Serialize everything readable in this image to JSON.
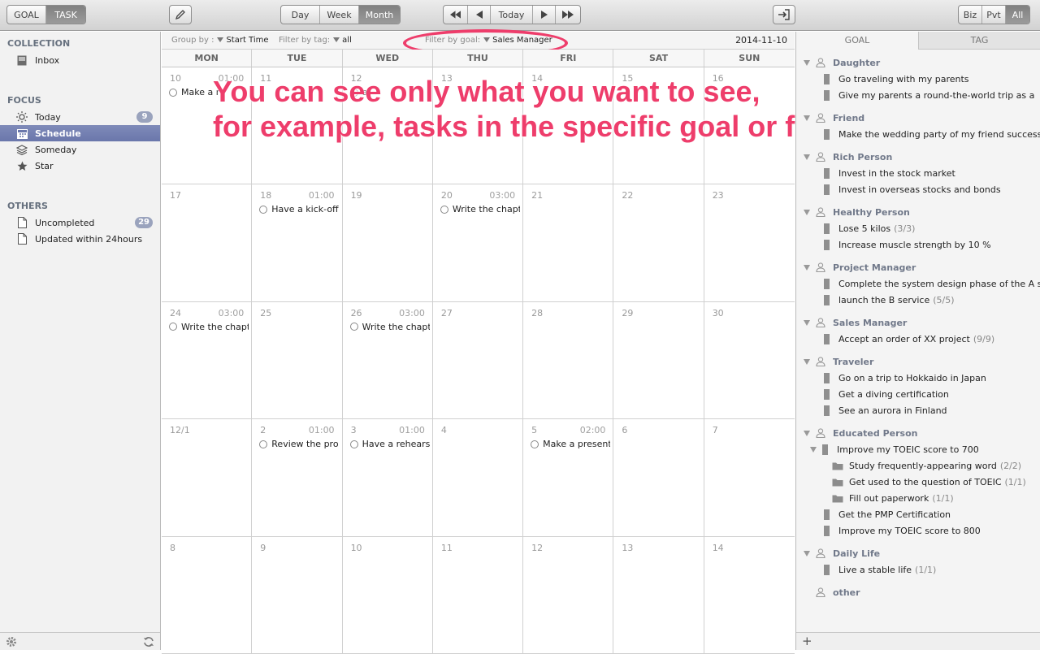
{
  "toolbar": {
    "mode_tabs": [
      "GOAL",
      "TASK"
    ],
    "view_tabs": [
      "Day",
      "Week",
      "Month"
    ],
    "nav_today": "Today",
    "scope_tabs": [
      "Biz",
      "Pvt",
      "All"
    ]
  },
  "sidebar": {
    "collection_title": "COLLECTION",
    "inbox": "Inbox",
    "focus_title": "FOCUS",
    "today": "Today",
    "today_count": "9",
    "schedule": "Schedule",
    "someday": "Someday",
    "star": "Star",
    "others_title": "OTHERS",
    "uncompleted": "Uncompleted",
    "uncompleted_count": "29",
    "updated": "Updated within 24hours"
  },
  "filter_bar": {
    "group_label": "Group by :",
    "group_value": "Start Time",
    "tag_label": "Filter by tag:",
    "tag_value": "all",
    "goal_label": "Filter by goal:",
    "goal_value": "Sales Manager",
    "date": "2014-11-10"
  },
  "calendar": {
    "weekdays": [
      "MON",
      "TUE",
      "WED",
      "THU",
      "FRI",
      "SAT",
      "SUN"
    ],
    "weeks": [
      [
        {
          "day": "10",
          "time": "01:00",
          "task": "Make a r"
        },
        {
          "day": "11",
          "time": "",
          "task": ""
        },
        {
          "day": "12",
          "time": "",
          "task": "a"
        },
        {
          "day": "13",
          "time": "",
          "task": ""
        },
        {
          "day": "14",
          "time": "",
          "task": ""
        },
        {
          "day": "15",
          "time": "",
          "task": ""
        },
        {
          "day": "16",
          "time": "",
          "task": ""
        }
      ],
      [
        {
          "day": "17",
          "time": "",
          "task": ""
        },
        {
          "day": "18",
          "time": "01:00",
          "task": "Have a kick-off"
        },
        {
          "day": "19",
          "time": "",
          "task": ""
        },
        {
          "day": "20",
          "time": "03:00",
          "task": "Write the chapt"
        },
        {
          "day": "21",
          "time": "",
          "task": ""
        },
        {
          "day": "22",
          "time": "",
          "task": ""
        },
        {
          "day": "23",
          "time": "",
          "task": ""
        }
      ],
      [
        {
          "day": "24",
          "time": "03:00",
          "task": "Write the chapt"
        },
        {
          "day": "25",
          "time": "",
          "task": ""
        },
        {
          "day": "26",
          "time": "03:00",
          "task": "Write the chapt"
        },
        {
          "day": "27",
          "time": "",
          "task": ""
        },
        {
          "day": "28",
          "time": "",
          "task": ""
        },
        {
          "day": "29",
          "time": "",
          "task": ""
        },
        {
          "day": "30",
          "time": "",
          "task": ""
        }
      ],
      [
        {
          "day": "12/1",
          "time": "",
          "task": ""
        },
        {
          "day": "2",
          "time": "01:00",
          "task": "Review the prop"
        },
        {
          "day": "3",
          "time": "01:00",
          "task": "Have a rehears"
        },
        {
          "day": "4",
          "time": "",
          "task": ""
        },
        {
          "day": "5",
          "time": "02:00",
          "task": "Make a present"
        },
        {
          "day": "6",
          "time": "",
          "task": ""
        },
        {
          "day": "7",
          "time": "",
          "task": ""
        }
      ],
      [
        {
          "day": "8",
          "time": "",
          "task": ""
        },
        {
          "day": "9",
          "time": "",
          "task": ""
        },
        {
          "day": "10",
          "time": "",
          "task": ""
        },
        {
          "day": "11",
          "time": "",
          "task": ""
        },
        {
          "day": "12",
          "time": "",
          "task": ""
        },
        {
          "day": "13",
          "time": "",
          "task": ""
        },
        {
          "day": "14",
          "time": "",
          "task": ""
        }
      ]
    ]
  },
  "overlay": {
    "line1": "You can see only what you want to see,",
    "line2": "for example, tasks in the specific goal or folder."
  },
  "goals_panel": {
    "tabs": [
      "GOAL",
      "TAG"
    ],
    "rows": [
      {
        "type": "role",
        "label": "Daughter",
        "count": ""
      },
      {
        "type": "goal",
        "label": "Go traveling with my parents",
        "count": ""
      },
      {
        "type": "goal",
        "label": "Give my parents a round-the-world trip as a",
        "count": ""
      },
      {
        "type": "role",
        "label": "Friend",
        "count": ""
      },
      {
        "type": "goal",
        "label": "Make the wedding party of my friend successful",
        "count": ""
      },
      {
        "type": "role",
        "label": "Rich Person",
        "count": ""
      },
      {
        "type": "goal",
        "label": "Invest in the stock market",
        "count": ""
      },
      {
        "type": "goal",
        "label": "Invest in overseas stocks and bonds",
        "count": ""
      },
      {
        "type": "role",
        "label": "Healthy Person",
        "count": ""
      },
      {
        "type": "goal",
        "label": "Lose 5 kilos",
        "count": "(3/3)"
      },
      {
        "type": "goal",
        "label": "Increase muscle strength by 10 %",
        "count": ""
      },
      {
        "type": "role",
        "label": "Project Manager",
        "count": ""
      },
      {
        "type": "goal",
        "label": "Complete the system design phase of the A s",
        "count": ""
      },
      {
        "type": "goal",
        "label": "launch the B service",
        "count": "(5/5)"
      },
      {
        "type": "role",
        "label": "Sales Manager",
        "count": ""
      },
      {
        "type": "goal",
        "label": "Accept an order of XX project",
        "count": "(9/9)"
      },
      {
        "type": "role",
        "label": "Traveler",
        "count": ""
      },
      {
        "type": "goal",
        "label": "Go on a trip to Hokkaido in Japan",
        "count": ""
      },
      {
        "type": "goal",
        "label": "Get a diving certification",
        "count": ""
      },
      {
        "type": "goal",
        "label": "See an aurora in Finland",
        "count": ""
      },
      {
        "type": "role",
        "label": "Educated Person",
        "count": ""
      },
      {
        "type": "goal-open",
        "label": "Improve my TOEIC score to 700",
        "count": ""
      },
      {
        "type": "folder",
        "label": "Study frequently-appearing word",
        "count": "(2/2)"
      },
      {
        "type": "folder",
        "label": "Get used to the question of TOEIC",
        "count": "(1/1)"
      },
      {
        "type": "folder",
        "label": "Fill out paperwork",
        "count": "(1/1)"
      },
      {
        "type": "goal",
        "label": "Get the PMP Certification",
        "count": ""
      },
      {
        "type": "goal",
        "label": "Improve my TOEIC score to 800",
        "count": ""
      },
      {
        "type": "role",
        "label": "Daily Life",
        "count": ""
      },
      {
        "type": "goal",
        "label": "Live a stable life",
        "count": "(1/1)"
      },
      {
        "type": "role-plain",
        "label": "other",
        "count": ""
      }
    ],
    "add_label": "+"
  },
  "colors": {
    "accent_highlight": "#ee3d6b",
    "sidebar_selected": "#6f7cae",
    "badge": "#9aa3bd"
  }
}
